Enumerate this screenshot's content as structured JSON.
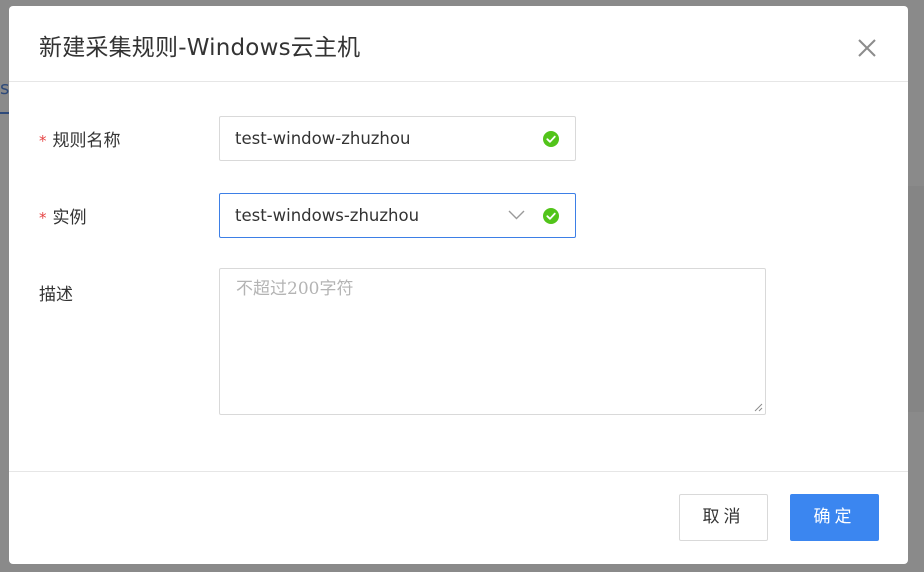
{
  "background": {
    "tab_fragment": "s"
  },
  "dialog": {
    "title": "新建采集规则-Windows云主机",
    "close_glyph": "×"
  },
  "form": {
    "rule_name": {
      "required_mark": "*",
      "label": "规则名称",
      "value": "test-window-zhuzhou",
      "valid": true
    },
    "instance": {
      "required_mark": "*",
      "label": "实例",
      "value": "test-windows-zhuzhou",
      "valid": true
    },
    "description": {
      "label": "描述",
      "placeholder": "不超过200字符",
      "value": ""
    }
  },
  "footer": {
    "cancel_label": "取消",
    "ok_label": "确定"
  },
  "colors": {
    "primary": "#3b86f0",
    "success": "#52c41a",
    "required": "#e64545",
    "overlay": "#7f7f7f"
  },
  "icons": {
    "close": "close-icon",
    "valid": "check-circle-icon",
    "dropdown": "chevron-down-icon",
    "resize": "resize-grip-icon"
  }
}
